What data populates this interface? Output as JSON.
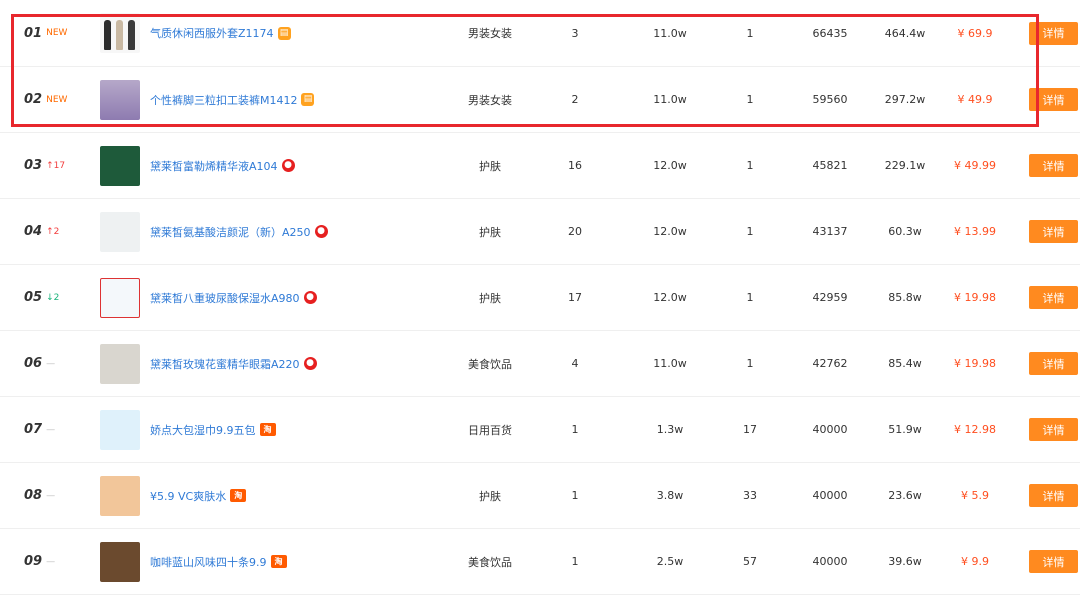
{
  "rows": [
    {
      "rank": "01",
      "change": "NEW",
      "change_type": "new",
      "name": "气质休闲西服外套Z1174",
      "badge": "doc",
      "badge_text": "▤",
      "category": "男装女装",
      "c1": "3",
      "c2": "11.0w",
      "c3": "1",
      "c4": "66435",
      "c5": "464.4w",
      "price": "¥ 69.9",
      "detail": "详情"
    },
    {
      "rank": "02",
      "change": "NEW",
      "change_type": "new",
      "name": "个性裤脚三粒扣工装裤M1412",
      "badge": "doc",
      "badge_text": "▤",
      "category": "男装女装",
      "c1": "2",
      "c2": "11.0w",
      "c3": "1",
      "c4": "59560",
      "c5": "297.2w",
      "price": "¥ 49.9",
      "detail": "详情"
    },
    {
      "rank": "03",
      "change": "↑17",
      "change_type": "up",
      "name": "黛莱皙富勒烯精华液A104",
      "badge": "fire",
      "badge_text": "●",
      "category": "护肤",
      "c1": "16",
      "c2": "12.0w",
      "c3": "1",
      "c4": "45821",
      "c5": "229.1w",
      "price": "¥ 49.99",
      "detail": "详情"
    },
    {
      "rank": "04",
      "change": "↑2",
      "change_type": "up",
      "name": "黛莱皙氨基酸洁颜泥（新）A250",
      "badge": "fire",
      "badge_text": "●",
      "category": "护肤",
      "c1": "20",
      "c2": "12.0w",
      "c3": "1",
      "c4": "43137",
      "c5": "60.3w",
      "price": "¥ 13.99",
      "detail": "详情"
    },
    {
      "rank": "05",
      "change": "↓2",
      "change_type": "down",
      "name": "黛莱皙八重玻尿酸保湿水A980",
      "badge": "fire",
      "badge_text": "●",
      "category": "护肤",
      "c1": "17",
      "c2": "12.0w",
      "c3": "1",
      "c4": "42959",
      "c5": "85.8w",
      "price": "¥ 19.98",
      "detail": "详情"
    },
    {
      "rank": "06",
      "change": "—",
      "change_type": "flat",
      "name": "黛莱皙玫瑰花蜜精华眼霜A220",
      "badge": "fire",
      "badge_text": "●",
      "category": "美食饮品",
      "c1": "4",
      "c2": "11.0w",
      "c3": "1",
      "c4": "42762",
      "c5": "85.4w",
      "price": "¥ 19.98",
      "detail": "详情"
    },
    {
      "rank": "07",
      "change": "—",
      "change_type": "flat",
      "name": "娇点大包湿巾9.9五包",
      "badge": "tao",
      "badge_text": "淘",
      "category": "日用百货",
      "c1": "1",
      "c2": "1.3w",
      "c3": "17",
      "c4": "40000",
      "c5": "51.9w",
      "price": "¥ 12.98",
      "detail": "详情"
    },
    {
      "rank": "08",
      "change": "—",
      "change_type": "flat",
      "name": "¥5.9 VC爽肤水",
      "badge": "tao",
      "badge_text": "淘",
      "category": "护肤",
      "c1": "1",
      "c2": "3.8w",
      "c3": "33",
      "c4": "40000",
      "c5": "23.6w",
      "price": "¥ 5.9",
      "detail": "详情"
    },
    {
      "rank": "09",
      "change": "—",
      "change_type": "flat",
      "name": "咖啡蓝山风味四十条9.9",
      "badge": "tao",
      "badge_text": "淘",
      "category": "美食饮品",
      "c1": "1",
      "c2": "2.5w",
      "c3": "57",
      "c4": "40000",
      "c5": "39.6w",
      "price": "¥ 9.9",
      "detail": "详情"
    }
  ]
}
